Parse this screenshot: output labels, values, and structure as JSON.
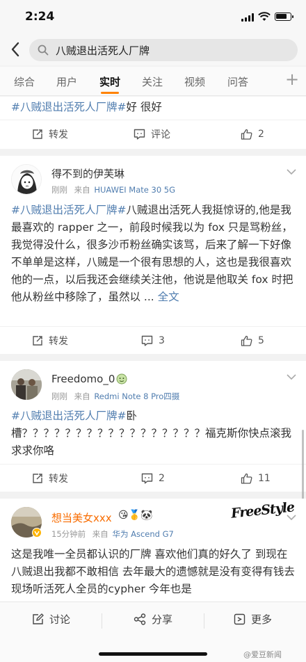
{
  "status": {
    "time": "2:24"
  },
  "search": {
    "query": "八贼退出活死人厂牌"
  },
  "tabs": [
    "综合",
    "用户",
    "实时",
    "关注",
    "视频",
    "问答"
  ],
  "tab_plus": "+",
  "actions": {
    "repost": "转发",
    "comment": "评论",
    "like": "赞"
  },
  "posts": [
    {
      "hashtag": "#八贼退出活死人厂牌#",
      "text": "好 很好",
      "repost_label": "转发",
      "comment_label": "评论",
      "likes": "2"
    },
    {
      "username": "得不到的伊芙琳",
      "time": "刚刚",
      "source_prefix": "来自",
      "source": "HUAWEI Mate 30 5G",
      "hashtag": "#八贼退出活死人厂牌#",
      "text": "八贼退出活死人我挺惊讶的,他是我最喜欢的 rapper 之一，前段时候我以为 fox 只是骂粉丝，我觉得没什么，很多沙币粉丝确实该骂，后来了解一下好像不单单是这样，八贼是一个很有思想的人，这也是我很喜欢他的一点，以后我还会继续关注他，他说是他取关 fox 时把他从粉丝中移除了，虽然以 ... ",
      "more": "全文",
      "repost_label": "转发",
      "comments": "3",
      "likes": "5"
    },
    {
      "username": "Freedomo_0",
      "time": "刚刚",
      "source_prefix": "来自",
      "source": "Redmi Note 8 Pro四摄",
      "hashtag": "#八贼退出活死人厂牌#",
      "text": "卧槽？？？？？？？？？？？？？？？？？福克斯你快点滚我求求你咯",
      "repost_label": "转发",
      "comments": "2",
      "likes": "11"
    },
    {
      "username": "想当美女xxx",
      "badge_emojis": "😘🥇🐼",
      "time": "15分钟前",
      "source_prefix": "来自",
      "source": "华为 Ascend G7",
      "text": "这是我唯一全员都认识的厂牌 喜欢他们真的好久了 到现在八贼退出我都不敢相信 去年最大的遗憾就是没有变得有钱去现场听活死人全员的cypher 今年也是",
      "sticker": "FreeStyle"
    }
  ],
  "bottom": {
    "discuss": "讨论",
    "share": "分享",
    "more": "更多"
  },
  "watermark": "@爱豆新闻",
  "colors": {
    "accent": "#ff8200",
    "link": "#507daf",
    "orange_name": "#f86c00"
  }
}
